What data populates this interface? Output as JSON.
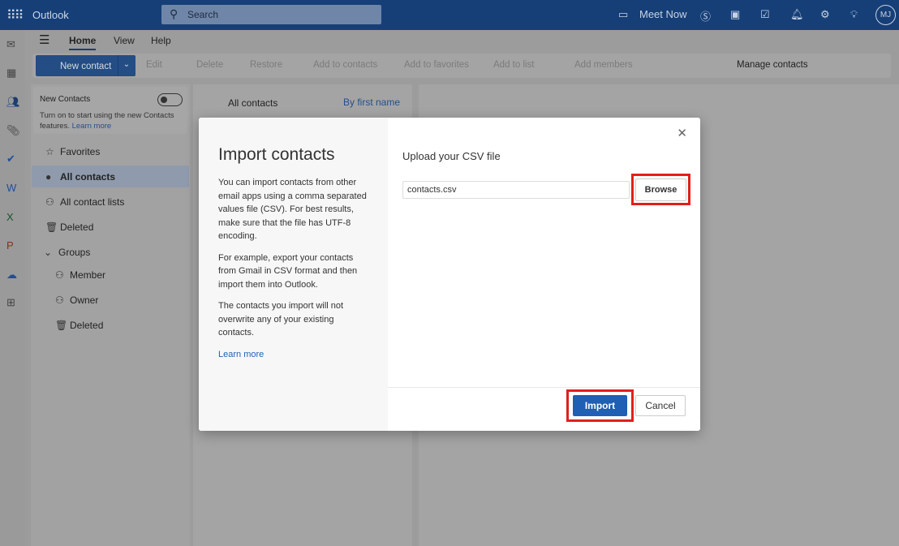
{
  "header": {
    "app": "Outlook",
    "search_placeholder": "Search",
    "meet_now": "Meet Now",
    "avatar": "MJ"
  },
  "tabs": [
    "Home",
    "View",
    "Help"
  ],
  "toolbar": {
    "new_contact": "New contact",
    "edit": "Edit",
    "delete": "Delete",
    "restore": "Restore",
    "add_to_contacts": "Add to contacts",
    "add_to_favorites": "Add to favorites",
    "add_to_list": "Add to list",
    "add_members": "Add members",
    "manage_contacts": "Manage contacts"
  },
  "left": {
    "new_contacts_title": "New Contacts",
    "new_contacts_desc": "Turn on to start using the new Contacts features.",
    "learn_more": "Learn more",
    "new_contacts_enabled": false,
    "items": [
      "Favorites",
      "All contacts",
      "All contact lists",
      "Deleted",
      "Groups",
      "Member",
      "Owner",
      "Deleted"
    ]
  },
  "list": {
    "title": "All contacts",
    "sort": "By first name"
  },
  "dialog": {
    "title": "Import contacts",
    "p1": "You can import contacts from other email apps using a comma separated values file (CSV). For best results, make sure that the file has UTF-8 encoding.",
    "p2": "For example, export your contacts from Gmail in CSV format and then import them into Outlook.",
    "p3": "The contacts you import will not overwrite any of your existing contacts.",
    "learn_more": "Learn more",
    "upload_label": "Upload your CSV file",
    "file_value": "contacts.csv",
    "browse": "Browse",
    "import": "Import",
    "cancel": "Cancel"
  }
}
